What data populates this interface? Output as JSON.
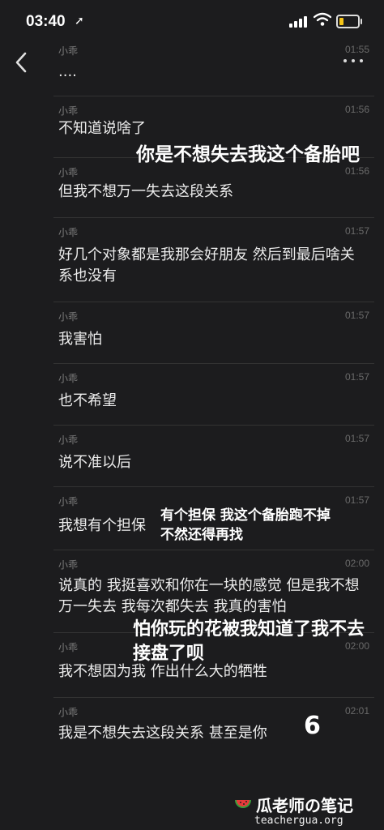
{
  "status_bar": {
    "time": "03:40",
    "location_icon": "location-arrow-icon",
    "signal_icon": "cellular-signal-icon",
    "wifi_icon": "wifi-icon",
    "battery_icon": "battery-low-icon",
    "battery_color": "#f5c518"
  },
  "header": {
    "back_icon": "chevron-left-icon",
    "more_icon": "more-dots-icon"
  },
  "messages": [
    {
      "sender": "小乖",
      "time": "01:55",
      "text": "...."
    },
    {
      "sender": "小乖",
      "time": "01:56",
      "text": "不知道说啥了"
    },
    {
      "sender": "小乖",
      "time": "01:56",
      "text": "但我不想万一失去这段关系"
    },
    {
      "sender": "小乖",
      "time": "01:57",
      "text": "好几个对象都是我那会好朋友 然后到最后啥关系也没有"
    },
    {
      "sender": "小乖",
      "time": "01:57",
      "text": "我害怕"
    },
    {
      "sender": "小乖",
      "time": "01:57",
      "text": "也不希望"
    },
    {
      "sender": "小乖",
      "time": "01:57",
      "text": "说不准以后"
    },
    {
      "sender": "小乖",
      "time": "01:57",
      "text": "我想有个担保"
    },
    {
      "sender": "小乖",
      "time": "02:00",
      "text": "说真的 我挺喜欢和你在一块的感觉 但是我不想万一失去 我每次都失去 我真的害怕"
    },
    {
      "sender": "小乖",
      "time": "02:00",
      "text": "我不想因为我 作出什么大的牺牲"
    },
    {
      "sender": "小乖",
      "time": "02:01",
      "text": "我是不想失去这段关系 甚至是你"
    }
  ],
  "annotations": {
    "a1": "你是不想失去我这个备胎吧",
    "a2": "有个担保 我这个备胎跑不掉 不然还得再找",
    "a3": "怕你玩的花被我知道了我不去接盘了呗",
    "a4": "6"
  },
  "watermark": {
    "icon": "watermelon-icon",
    "title": "瓜老师の笔记",
    "url": "teachergua.org"
  }
}
